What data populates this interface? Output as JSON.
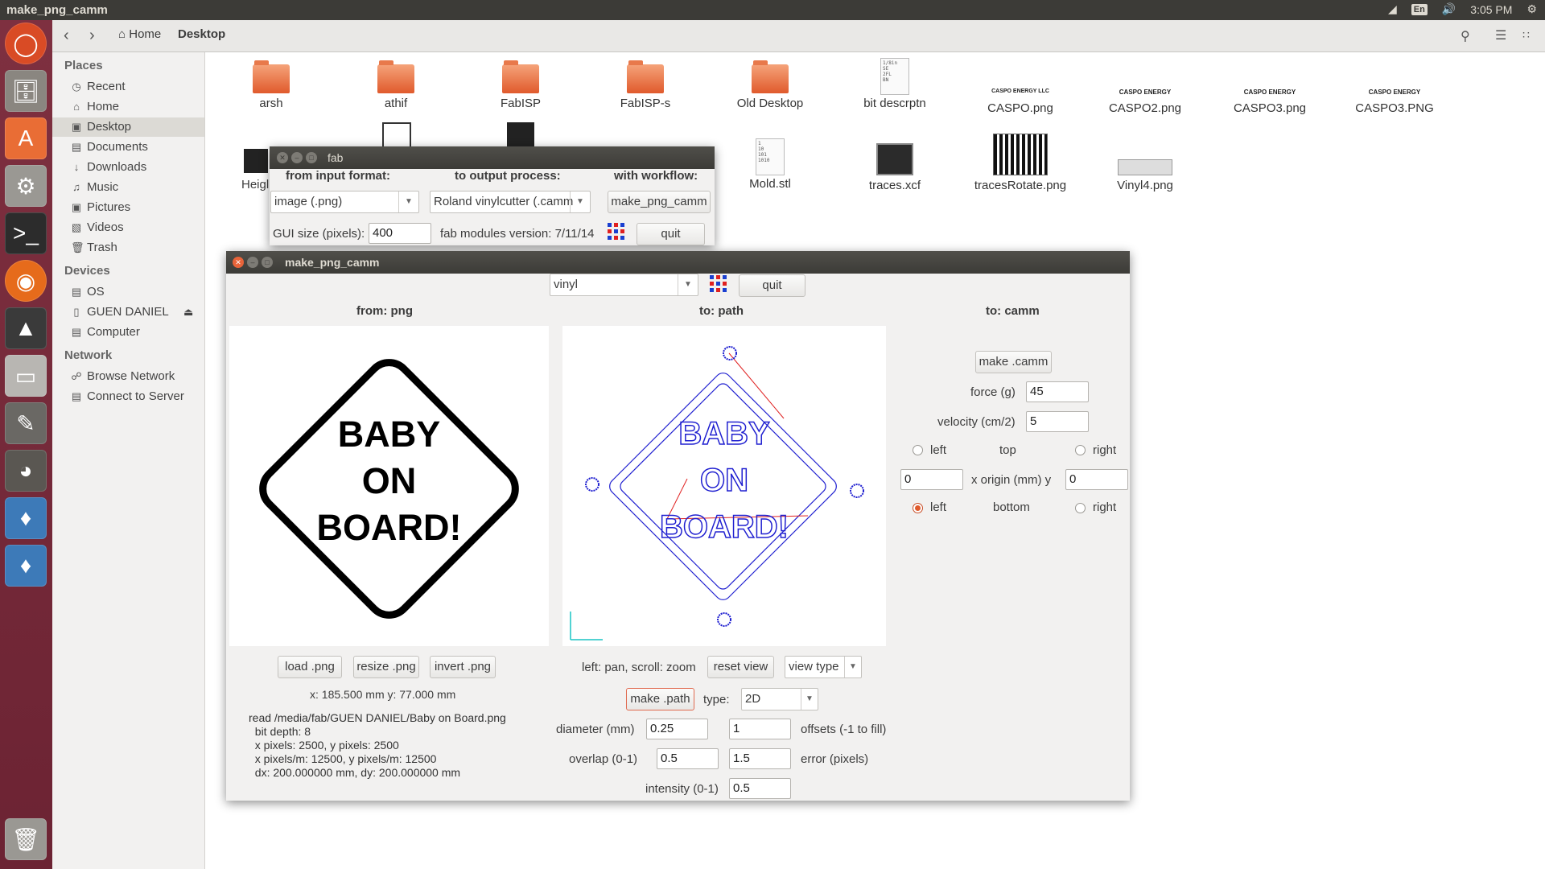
{
  "topbar": {
    "title": "make_png_camm",
    "keyboard": "En",
    "time": "3:05 PM"
  },
  "nav": {
    "home": "Home",
    "current": "Desktop"
  },
  "sidebar": {
    "places_head": "Places",
    "places": [
      {
        "label": "Recent",
        "icon": "clock-icon"
      },
      {
        "label": "Home",
        "icon": "home-icon"
      },
      {
        "label": "Desktop",
        "icon": "desktop-icon"
      },
      {
        "label": "Documents",
        "icon": "document-icon"
      },
      {
        "label": "Downloads",
        "icon": "download-icon"
      },
      {
        "label": "Music",
        "icon": "music-icon"
      },
      {
        "label": "Pictures",
        "icon": "picture-icon"
      },
      {
        "label": "Videos",
        "icon": "video-icon"
      },
      {
        "label": "Trash",
        "icon": "trash-icon"
      }
    ],
    "devices_head": "Devices",
    "devices": [
      {
        "label": "OS",
        "icon": "drive-icon"
      },
      {
        "label": "GUEN DANIEL",
        "icon": "usb-icon"
      },
      {
        "label": "Computer",
        "icon": "computer-icon"
      }
    ],
    "network_head": "Network",
    "network": [
      {
        "label": "Browse Network",
        "icon": "network-icon"
      },
      {
        "label": "Connect to Server",
        "icon": "server-icon"
      }
    ]
  },
  "files": {
    "row1": [
      "arsh",
      "athif",
      "FabISP",
      "FabISP-s",
      "Old Desktop",
      "bit descrptn",
      "CASPO.png",
      "CASPO2.png",
      "CASPO3.png",
      "CASPO3.PNG"
    ],
    "row1_thumbs": [
      "CASPO ENERGY LLC",
      "CASPO ENERGY",
      "CASPO ENERGY",
      "CASPO ENERGY"
    ],
    "row2_partial": "Heigl",
    "row2": [
      "Mold.stl",
      "traces.xcf",
      "tracesRotate.png",
      "Vinyl4.png"
    ],
    "bit_doc": "1/8in\nSE\n2FL\nBN",
    "mold_doc": "1\n10\n101\n1010"
  },
  "fab": {
    "title": "fab",
    "from_label": "from input format:",
    "to_label": "to output process:",
    "workflow_label": "with workflow:",
    "input_format": "image (.png)",
    "output_process": "Roland vinylcutter (.camm",
    "workflow_button": "make_png_camm",
    "gui_size_label": "GUI size (pixels):",
    "gui_size": "400",
    "version": "fab modules version: 7/11/14",
    "quit": "quit"
  },
  "camm": {
    "title": "make_png_camm",
    "material": "vinyl",
    "quit": "quit",
    "from_head": "from: png",
    "path_head": "to: path",
    "camm_head": "to: camm",
    "sign": [
      "BABY",
      "ON",
      "BOARD!"
    ],
    "load": "load .png",
    "resize": "resize .png",
    "invert": "invert .png",
    "dims": "x: 185.500 mm  y: 77.000 mm",
    "info": "read /media/fab/GUEN DANIEL/Baby on Board.png\n  bit depth: 8\n  x pixels: 2500, y pixels: 2500\n  x pixels/m: 12500, y pixels/m: 12500\n  dx: 200.000000 mm, dy: 200.000000 mm",
    "pan_hint": "left: pan, scroll: zoom",
    "reset_view": "reset view",
    "view_type": "view type",
    "make_path": "make .path",
    "type_label": "type:",
    "type": "2D",
    "diameter_label": "diameter (mm)",
    "diameter": "0.25",
    "offsets": "1",
    "offsets_label": "offsets (-1 to fill)",
    "overlap_label": "overlap (0-1)",
    "overlap": "0.5",
    "error": "1.5",
    "error_label": "error (pixels)",
    "intensity_label": "intensity (0-1)",
    "intensity": "0.5",
    "make_camm": "make .camm",
    "force_label": "force (g)",
    "force": "45",
    "velocity_label": "velocity (cm/2)",
    "velocity": "5",
    "left": "left",
    "top": "top",
    "right": "right",
    "bottom": "bottom",
    "x_origin": "0",
    "origin_label": "x  origin (mm)  y",
    "y_origin": "0",
    "origin_selected": "bottom-left"
  },
  "colors": {
    "accent": "#e05a2c",
    "path_blue": "#1f1fd0",
    "path_red": "#e02020"
  }
}
